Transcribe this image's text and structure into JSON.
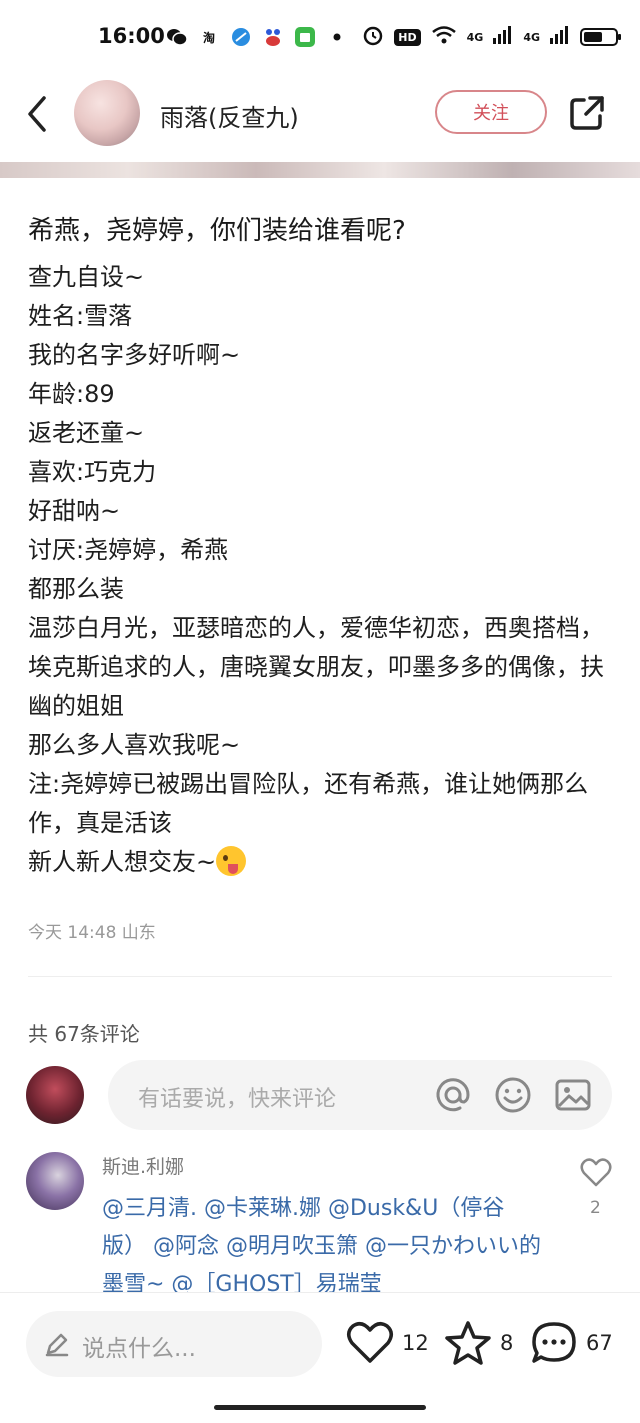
{
  "status_bar": {
    "time": "16:00",
    "app_icons": [
      "wechat-icon",
      "taobao-icon",
      "browser-icon",
      "baidu-icon",
      "store-icon"
    ],
    "taobao_glyph": "淘",
    "hd_badge": "HD",
    "network_1": "4G",
    "network_2": "4G",
    "battery_level": 0.6
  },
  "header": {
    "author_name": "雨落(反查九)",
    "follow_label": "关注"
  },
  "post": {
    "title": "希燕，尧婷婷，你们装给谁看呢?",
    "lines": [
      "查九自设~",
      "姓名:雪落",
      "我的名字多好听啊~",
      "年龄:89",
      "返老还童~",
      "喜欢:巧克力",
      "好甜呐~",
      "讨厌:尧婷婷，希燕",
      "都那么装",
      "温莎白月光，亚瑟暗恋的人，爱德华初恋，西奥搭档，埃克斯追求的人，唐晓翼女朋友，叩墨多多的偶像，扶幽的姐姐",
      "那么多人喜欢我呢~",
      "注:尧婷婷已被踢出冒险队，还有希燕，谁让她俩那么作，真是活该",
      "新人新人想交友~"
    ],
    "meta": "今天 14:48 山东"
  },
  "comments": {
    "count_label": "共 67条评论",
    "input_placeholder": "有话要说，快来评论",
    "first": {
      "user": "斯迪.利娜",
      "text": "@三月清. @卡莱琳.娜 @Dusk&U（停谷版） @阿念 @明月吹玉箫 @一只かわいい的墨雪~ @［GHOST］易瑞莹",
      "likes": "2"
    }
  },
  "bottom_bar": {
    "say_placeholder": "说点什么...",
    "likes": "12",
    "stars": "8",
    "comments": "67"
  },
  "colors": {
    "accent": "#d2505a",
    "mention": "#3a6aa8"
  }
}
